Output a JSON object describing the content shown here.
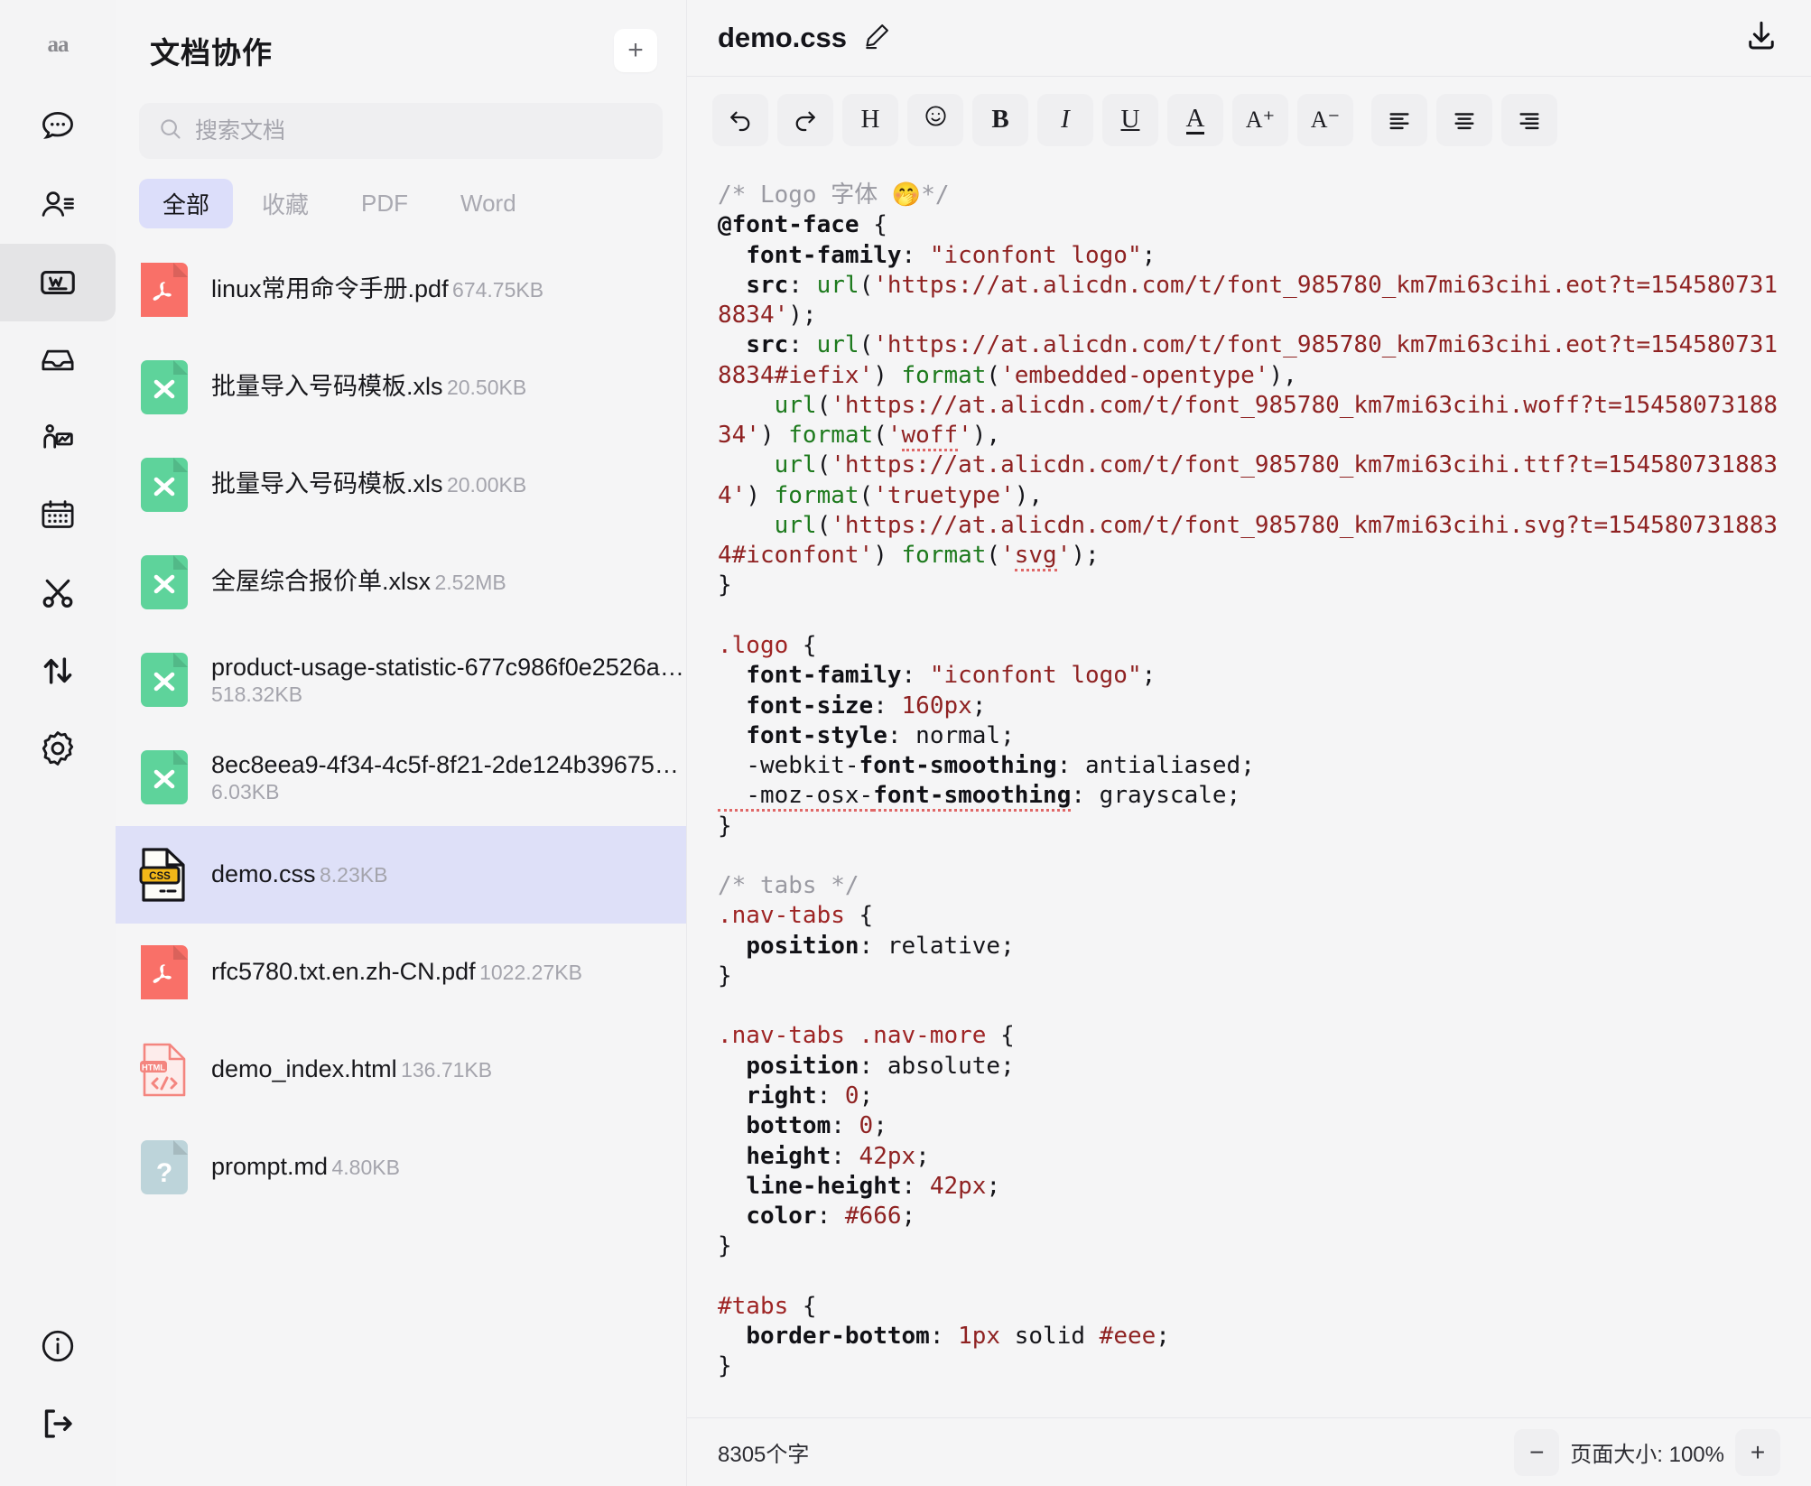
{
  "rail": {
    "logo": "aa",
    "items": [
      {
        "name": "chat-icon",
        "label": "消息"
      },
      {
        "name": "contacts-icon",
        "label": "通讯录"
      },
      {
        "name": "docs-icon",
        "label": "文档协作",
        "active": true
      },
      {
        "name": "inbox-icon",
        "label": "收件箱"
      },
      {
        "name": "report-icon",
        "label": "报表"
      },
      {
        "name": "calendar-icon",
        "label": "日历"
      },
      {
        "name": "scissors-icon",
        "label": "剪贴"
      },
      {
        "name": "transfer-icon",
        "label": "传输"
      },
      {
        "name": "settings-icon",
        "label": "设置"
      }
    ],
    "bottom": [
      {
        "name": "info-icon",
        "label": "关于"
      },
      {
        "name": "logout-icon",
        "label": "退出"
      }
    ]
  },
  "filelist": {
    "title": "文档协作",
    "add_label": "+",
    "search": {
      "placeholder": "搜索文档",
      "value": ""
    },
    "tabs": [
      {
        "label": "全部",
        "active": true
      },
      {
        "label": "收藏",
        "active": false
      },
      {
        "label": "PDF",
        "active": false
      },
      {
        "label": "Word",
        "active": false
      }
    ],
    "files": [
      {
        "name": "linux常用命令手册.pdf",
        "size": "674.75KB",
        "type": "pdf",
        "selected": false
      },
      {
        "name": "批量导入号码模板.xls",
        "size": "20.50KB",
        "type": "xls",
        "selected": false
      },
      {
        "name": "批量导入号码模板.xls",
        "size": "20.00KB",
        "type": "xls",
        "selected": false
      },
      {
        "name": "全屋综合报价单.xlsx",
        "size": "2.52MB",
        "type": "xls",
        "selected": false
      },
      {
        "name": "product-usage-statistic-677c986f0e2526a…",
        "size": "518.32KB",
        "type": "xls",
        "selected": false
      },
      {
        "name": "8ec8eea9-4f34-4c5f-8f21-2de124b39675…",
        "size": "6.03KB",
        "type": "xls",
        "selected": false
      },
      {
        "name": "demo.css",
        "size": "8.23KB",
        "type": "css",
        "selected": true
      },
      {
        "name": "rfc5780.txt.en.zh-CN.pdf",
        "size": "1022.27KB",
        "type": "pdf",
        "selected": false
      },
      {
        "name": "demo_index.html",
        "size": "136.71KB",
        "type": "html",
        "selected": false
      },
      {
        "name": "prompt.md",
        "size": "4.80KB",
        "type": "unknown",
        "selected": false
      }
    ]
  },
  "editor": {
    "doc_title": "demo.css",
    "edit_icon": "pencil-icon",
    "download_icon": "download-icon",
    "toolbar": [
      {
        "name": "undo-button",
        "glyph": "↶"
      },
      {
        "name": "redo-button",
        "glyph": "↷"
      },
      {
        "name": "heading-button",
        "glyph": "H"
      },
      {
        "name": "emoji-button",
        "glyph": "☺"
      },
      {
        "name": "bold-button",
        "glyph": "B"
      },
      {
        "name": "italic-button",
        "glyph": "I"
      },
      {
        "name": "underline-button",
        "glyph": "U"
      },
      {
        "name": "text-color-button",
        "glyph": "A"
      },
      {
        "name": "font-increase-button",
        "glyph": "A⁺"
      },
      {
        "name": "font-decrease-button",
        "glyph": "A⁻"
      },
      {
        "name": "align-left-button",
        "glyph": "≡"
      },
      {
        "name": "align-center-button",
        "glyph": "≡"
      },
      {
        "name": "align-right-button",
        "glyph": "≡"
      }
    ],
    "status": {
      "word_count": "8305个字",
      "zoom_out_label": "−",
      "zoom_label": "页面大小: 100%",
      "zoom_in_label": "+"
    },
    "code_lines": [
      [
        {
          "t": "cm",
          "s": "/* Logo 字体 "
        },
        {
          "t": "emoji",
          "s": "🤭"
        },
        {
          "t": "cm",
          "s": "*/"
        }
      ],
      [
        {
          "t": "prop",
          "s": "@font-face"
        },
        {
          "t": "pl",
          "s": " {"
        }
      ],
      [
        {
          "t": "prop",
          "s": "  font-family"
        },
        {
          "t": "pl",
          "s": ": "
        },
        {
          "t": "str",
          "s": "\"iconfont logo\""
        },
        {
          "t": "pl",
          "s": ";"
        }
      ],
      [
        {
          "t": "prop",
          "s": "  src"
        },
        {
          "t": "pl",
          "s": ": "
        },
        {
          "t": "fn",
          "s": "url"
        },
        {
          "t": "pl",
          "s": "("
        },
        {
          "t": "str",
          "s": "'https://at.alicdn.com/t/font_985780_km7mi63cihi.eot?t=1545807318834'"
        },
        {
          "t": "pl",
          "s": ");"
        }
      ],
      [
        {
          "t": "prop",
          "s": "  src"
        },
        {
          "t": "pl",
          "s": ": "
        },
        {
          "t": "fn",
          "s": "url"
        },
        {
          "t": "pl",
          "s": "("
        },
        {
          "t": "str",
          "s": "'https://at.alicdn.com/t/font_985780_km7mi63cihi.eot?t=1545807318834#iefix'"
        },
        {
          "t": "pl",
          "s": ") "
        },
        {
          "t": "fn",
          "s": "format"
        },
        {
          "t": "pl",
          "s": "("
        },
        {
          "t": "str",
          "s": "'embedded-opentype'"
        },
        {
          "t": "pl",
          "s": "),"
        }
      ],
      [
        {
          "t": "pl",
          "s": "    "
        },
        {
          "t": "fn",
          "s": "url"
        },
        {
          "t": "pl",
          "s": "("
        },
        {
          "t": "str",
          "s": "'https://at.alicdn.com/t/font_985780_km7mi63cihi.woff?t=1545807318834'"
        },
        {
          "t": "pl",
          "s": ") "
        },
        {
          "t": "fn",
          "s": "format"
        },
        {
          "t": "pl",
          "s": "("
        },
        {
          "t": "str",
          "s": "'"
        },
        {
          "t": "str sq",
          "s": "woff"
        },
        {
          "t": "str",
          "s": "'"
        },
        {
          "t": "pl",
          "s": "),"
        }
      ],
      [
        {
          "t": "pl",
          "s": "    "
        },
        {
          "t": "fn",
          "s": "url"
        },
        {
          "t": "pl",
          "s": "("
        },
        {
          "t": "str",
          "s": "'https://at.alicdn.com/t/font_985780_km7mi63cihi.ttf?t=1545807318834'"
        },
        {
          "t": "pl",
          "s": ") "
        },
        {
          "t": "fn",
          "s": "format"
        },
        {
          "t": "pl",
          "s": "("
        },
        {
          "t": "str",
          "s": "'truetype'"
        },
        {
          "t": "pl",
          "s": "),"
        }
      ],
      [
        {
          "t": "pl",
          "s": "    "
        },
        {
          "t": "fn",
          "s": "url"
        },
        {
          "t": "pl",
          "s": "("
        },
        {
          "t": "str",
          "s": "'https://at.alicdn.com/t/font_985780_km7mi63cihi.svg?t=1545807318834#iconfont'"
        },
        {
          "t": "pl",
          "s": ") "
        },
        {
          "t": "fn",
          "s": "format"
        },
        {
          "t": "pl",
          "s": "("
        },
        {
          "t": "str",
          "s": "'"
        },
        {
          "t": "str sq",
          "s": "svg"
        },
        {
          "t": "str",
          "s": "'"
        },
        {
          "t": "pl",
          "s": ");"
        }
      ],
      [
        {
          "t": "pl",
          "s": "}"
        }
      ],
      [
        {
          "t": "pl",
          "s": ""
        }
      ],
      [
        {
          "t": "sel",
          "s": ".logo"
        },
        {
          "t": "pl",
          "s": " {"
        }
      ],
      [
        {
          "t": "prop",
          "s": "  font-family"
        },
        {
          "t": "pl",
          "s": ": "
        },
        {
          "t": "str",
          "s": "\"iconfont logo\""
        },
        {
          "t": "pl",
          "s": ";"
        }
      ],
      [
        {
          "t": "prop",
          "s": "  font-size"
        },
        {
          "t": "pl",
          "s": ": "
        },
        {
          "t": "str",
          "s": "160px"
        },
        {
          "t": "pl",
          "s": ";"
        }
      ],
      [
        {
          "t": "prop",
          "s": "  font-style"
        },
        {
          "t": "pl",
          "s": ": normal;"
        }
      ],
      [
        {
          "t": "pl",
          "s": "  -webkit-"
        },
        {
          "t": "prop",
          "s": "font-smoothing"
        },
        {
          "t": "pl",
          "s": ": antialiased;"
        }
      ],
      [
        {
          "t": "pl sq",
          "s": "  -moz-osx-"
        },
        {
          "t": "prop sq",
          "s": "font-smoothing"
        },
        {
          "t": "pl",
          "s": ": grayscale;"
        }
      ],
      [
        {
          "t": "pl",
          "s": "}"
        }
      ],
      [
        {
          "t": "pl",
          "s": ""
        }
      ],
      [
        {
          "t": "cm",
          "s": "/* tabs */"
        }
      ],
      [
        {
          "t": "sel",
          "s": ".nav-tabs"
        },
        {
          "t": "pl",
          "s": " {"
        }
      ],
      [
        {
          "t": "prop",
          "s": "  position"
        },
        {
          "t": "pl",
          "s": ": relative;"
        }
      ],
      [
        {
          "t": "pl",
          "s": "}"
        }
      ],
      [
        {
          "t": "pl",
          "s": ""
        }
      ],
      [
        {
          "t": "sel",
          "s": ".nav-tabs .nav-more"
        },
        {
          "t": "pl",
          "s": " {"
        }
      ],
      [
        {
          "t": "prop",
          "s": "  position"
        },
        {
          "t": "pl",
          "s": ": absolute;"
        }
      ],
      [
        {
          "t": "prop",
          "s": "  right"
        },
        {
          "t": "pl",
          "s": ": "
        },
        {
          "t": "str",
          "s": "0"
        },
        {
          "t": "pl",
          "s": ";"
        }
      ],
      [
        {
          "t": "prop",
          "s": "  bottom"
        },
        {
          "t": "pl",
          "s": ": "
        },
        {
          "t": "str",
          "s": "0"
        },
        {
          "t": "pl",
          "s": ";"
        }
      ],
      [
        {
          "t": "prop",
          "s": "  height"
        },
        {
          "t": "pl",
          "s": ": "
        },
        {
          "t": "str",
          "s": "42px"
        },
        {
          "t": "pl",
          "s": ";"
        }
      ],
      [
        {
          "t": "prop",
          "s": "  line-height"
        },
        {
          "t": "pl",
          "s": ": "
        },
        {
          "t": "str",
          "s": "42px"
        },
        {
          "t": "pl",
          "s": ";"
        }
      ],
      [
        {
          "t": "prop",
          "s": "  color"
        },
        {
          "t": "pl",
          "s": ": "
        },
        {
          "t": "str",
          "s": "#666"
        },
        {
          "t": "pl",
          "s": ";"
        }
      ],
      [
        {
          "t": "pl",
          "s": "}"
        }
      ],
      [
        {
          "t": "pl",
          "s": ""
        }
      ],
      [
        {
          "t": "sel",
          "s": "#tabs"
        },
        {
          "t": "pl",
          "s": " {"
        }
      ],
      [
        {
          "t": "prop",
          "s": "  border-bottom"
        },
        {
          "t": "pl",
          "s": ": "
        },
        {
          "t": "str",
          "s": "1px"
        },
        {
          "t": "pl",
          "s": " solid "
        },
        {
          "t": "str",
          "s": "#eee"
        },
        {
          "t": "pl",
          "s": ";"
        }
      ],
      [
        {
          "t": "pl",
          "s": "}"
        }
      ]
    ]
  },
  "colors": {
    "accent_selected": "#dee0f8",
    "tab_active": "#dcdefa",
    "pdf": "#f97068",
    "xls": "#5ed39b",
    "css_badge": "#f2b718",
    "html": "#f4857f",
    "unknown": "#bdd4da",
    "bg": "#f5f5f6"
  }
}
